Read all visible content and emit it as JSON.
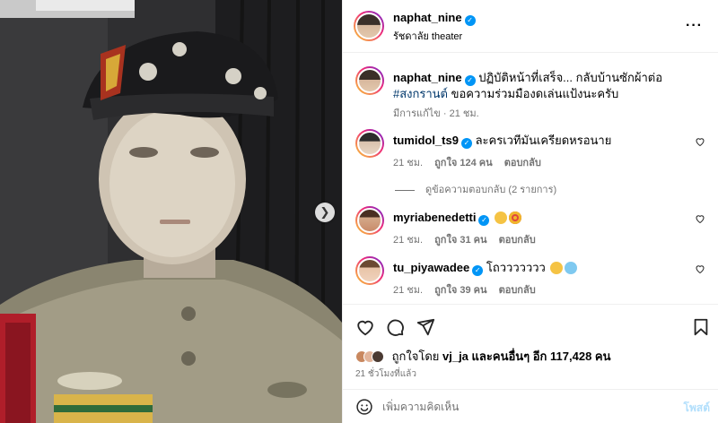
{
  "post": {
    "author": "naphat_nine",
    "location": "รัชดาลัย theater",
    "caption_text": "ปฏิบัติหน้าที่เสร็จ... กลับบ้านซักผ้าต่อ",
    "caption_hashtag": "#สงกรานต์",
    "caption_rest": " ขอความร่วมมืองดเล่นแป้งนะครับ",
    "caption_meta": "มีการแก้ไข · 21 ชม."
  },
  "comments": [
    {
      "user": "tumidol_ts9",
      "text": "ละครเวทีมันเครียดหรอนาย",
      "time": "21 ชม.",
      "likes": "ถูกใจ 124 คน",
      "reply": "ตอบกลับ",
      "view_replies": "ดูข้อความตอบกลับ (2 รายการ)"
    },
    {
      "user": "myriabenedetti",
      "text": "",
      "emojis": [
        "#f5c344",
        "#f0b62c"
      ],
      "time": "21 ชม.",
      "likes": "ถูกใจ 31 คน",
      "reply": "ตอบกลับ"
    },
    {
      "user": "tu_piyawadee",
      "text": "โถววววววว",
      "emojis": [
        "#f5c344",
        "#7fc9f0"
      ],
      "time": "21 ชม.",
      "likes": "ถูกใจ 39 คน",
      "reply": "ตอบกลับ"
    }
  ],
  "likes": {
    "prefix": "ถูกใจโดย",
    "user": "vj_ja",
    "joiner": "และ",
    "others": "คนอื่นๆ อีก 117,428 คน"
  },
  "timestamp": "21 ชั่วโมงที่แล้ว",
  "composer": {
    "placeholder": "เพิ่มความคิดเห็น",
    "post_label": "โพสต์"
  },
  "icons": {
    "verified": "verified-badge-icon",
    "more": "more-options-icon",
    "next": "chevron-right-icon",
    "like": "heart-icon",
    "comment": "comment-icon",
    "share": "paper-plane-icon",
    "save": "bookmark-icon",
    "emoji": "emoji-icon"
  },
  "colors": {
    "accent": "#0095f6",
    "hashtag": "#00376b",
    "muted": "#737373",
    "post_disabled": "#b2dffc"
  }
}
